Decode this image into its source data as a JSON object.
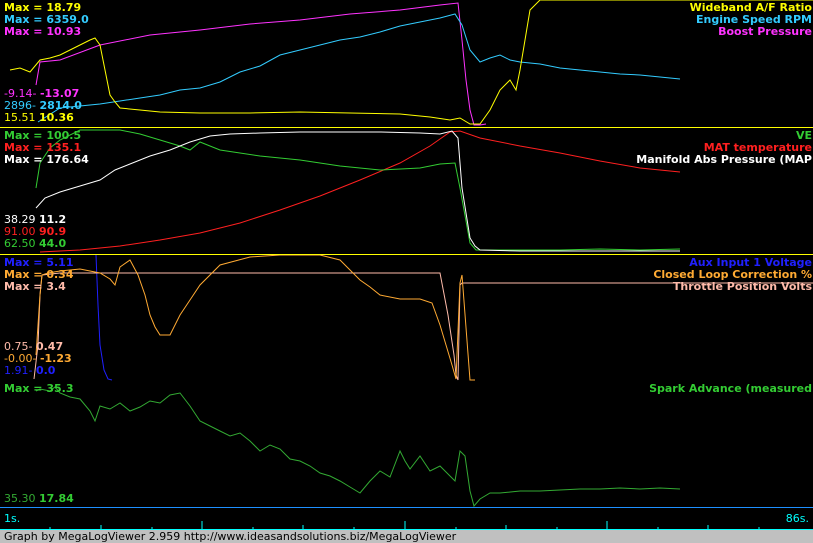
{
  "panels": [
    {
      "labels_right": [
        {
          "text": "Wideband A/F Ratio",
          "color": "#ffff00"
        },
        {
          "text": "Engine Speed RPM",
          "color": "#33ccff"
        },
        {
          "text": "Boost Pressure",
          "color": "#ff33ff"
        }
      ],
      "max_labels": [
        {
          "text": "Max = 18.79",
          "color": "#ffff00"
        },
        {
          "text": "Max = 6359.0",
          "color": "#33ccff"
        },
        {
          "text": "Max = 10.93",
          "color": "#ff33ff"
        }
      ],
      "readouts": [
        {
          "min": "-9.14-",
          "cur": "-13.07",
          "color": "#ff33ff"
        },
        {
          "min": "2896-",
          "cur": "2814.0",
          "color": "#33ccff"
        },
        {
          "min": "15.51",
          "cur": "10.36",
          "color": "#ffff00"
        }
      ]
    },
    {
      "labels_right": [
        {
          "text": "VE",
          "color": "#33cc33"
        },
        {
          "text": "MAT temperature",
          "color": "#ff2020"
        },
        {
          "text": "Manifold Abs Pressure (MAP",
          "color": "#ffffff"
        }
      ],
      "max_labels": [
        {
          "text": "Max = 100.5",
          "color": "#33cc33"
        },
        {
          "text": "Max = 135.1",
          "color": "#ff2020"
        },
        {
          "text": "Max = 176.64",
          "color": "#ffffff"
        }
      ],
      "readouts": [
        {
          "min": "38.29",
          "cur": "11.2",
          "color": "#ffffff"
        },
        {
          "min": "91.00",
          "cur": "90.9",
          "color": "#ff2020"
        },
        {
          "min": "62.50",
          "cur": "44.0",
          "color": "#33cc33"
        }
      ]
    },
    {
      "labels_right": [
        {
          "text": "Aux Input 1 Voltage",
          "color": "#2020ff"
        },
        {
          "text": "Closed Loop Correction %",
          "color": "#ffaa33"
        },
        {
          "text": "Throttle Position Volts",
          "color": "#ffbbaa"
        }
      ],
      "max_labels": [
        {
          "text": "Max = 5.11",
          "color": "#2020ff"
        },
        {
          "text": "Max = 0.34",
          "color": "#ffaa33"
        },
        {
          "text": "Max = 3.4",
          "color": "#ffbbaa"
        }
      ],
      "readouts": [
        {
          "min": "0.75-",
          "cur": "0.47",
          "color": "#ffbbaa"
        },
        {
          "min": "-0.00-",
          "cur": "-1.23",
          "color": "#ffaa33"
        },
        {
          "min": "1.91-",
          "cur": "0.0",
          "color": "#2020ff"
        }
      ]
    },
    {
      "labels_right": [
        {
          "text": "Spark Advance (measured",
          "color": "#33cc33"
        }
      ],
      "max_labels": [
        {
          "text": "Max = 35.3",
          "color": "#33cc33"
        }
      ],
      "readouts": [
        {
          "min": "35.30",
          "cur": "17.84",
          "color": "#33cc33"
        }
      ]
    }
  ],
  "timeline": {
    "start": "1s.",
    "end": "86s."
  },
  "footer": "Graph by MegaLogViewer 2.959 http://www.ideasandsolutions.biz/MegaLogViewer",
  "colors": {
    "border_top": "#ffff00",
    "border_panel": "#1e90ff",
    "tick": "#00ffff"
  }
}
